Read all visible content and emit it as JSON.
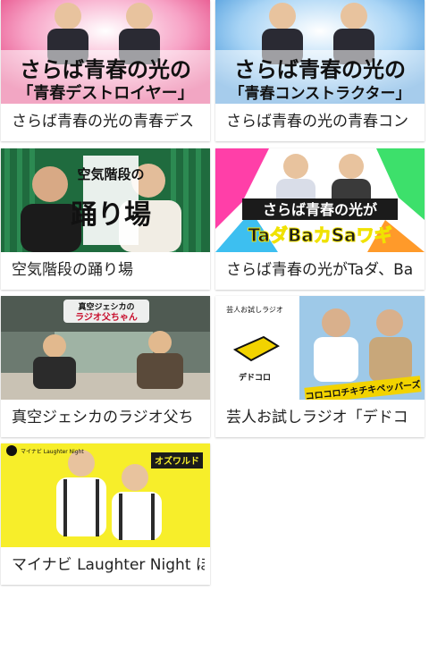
{
  "cards": [
    {
      "title": "さらば青春の光の青春デス",
      "thumb_text": [
        "さらば青春の光の",
        "「青春デストロイヤー」"
      ],
      "accent": "#e23b7a"
    },
    {
      "title": "さらば青春の光の青春コン",
      "thumb_text": [
        "さらば青春の光の",
        "「青春コンストラクター」"
      ],
      "accent": "#3a8fd6"
    },
    {
      "title": "空気階段の踊り場",
      "thumb_text": [
        "空気階段の",
        "踊り場"
      ],
      "accent": "#1f6b3e"
    },
    {
      "title": "さらば青春の光がTaダ、Ba",
      "thumb_text": [
        "さらば青春の光が",
        "TaダBaカSaワギ"
      ],
      "accent": "#f0e200"
    },
    {
      "title": "真空ジェシカのラジオ父ち",
      "thumb_text": [
        "真空ジェシカの",
        "ラジオ父ちゃん"
      ],
      "accent": "#c8102e"
    },
    {
      "title": "芸人お試しラジオ「デドコ",
      "thumb_text": [
        "芸人お試しラジオ",
        "デドコロ",
        "コロコロチキチキペッパーズ"
      ],
      "accent": "#f2d300"
    },
    {
      "title": "マイナビ Laughter Night ほ",
      "thumb_text": [
        "マイナビ Laughter Night",
        "オズワルド"
      ],
      "accent": "#f7ee2a"
    }
  ]
}
